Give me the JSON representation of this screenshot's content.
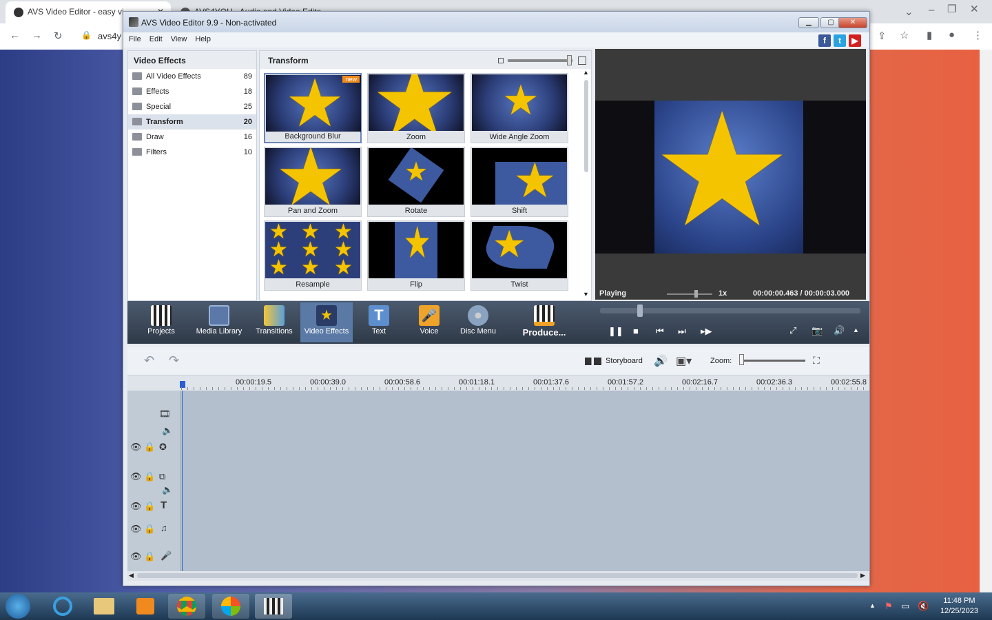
{
  "browser": {
    "tabs": [
      "AVS Video Editor - easy vi...",
      "AVS4YOU - Audio and Video Edito..."
    ],
    "address": "avs4y"
  },
  "app": {
    "title": "AVS Video Editor 9.9 - Non-activated",
    "menu": [
      "File",
      "Edit",
      "View",
      "Help"
    ]
  },
  "categories": {
    "header": "Video Effects",
    "items": [
      {
        "label": "All Video Effects",
        "count": "89"
      },
      {
        "label": "Effects",
        "count": "18"
      },
      {
        "label": "Special",
        "count": "25"
      },
      {
        "label": "Transform",
        "count": "20"
      },
      {
        "label": "Draw",
        "count": "16"
      },
      {
        "label": "Filters",
        "count": "10"
      }
    ]
  },
  "effects": {
    "header": "Transform",
    "new_badge": "new",
    "items": [
      "Background Blur",
      "Zoom",
      "Wide Angle Zoom",
      "Pan and Zoom",
      "Rotate",
      "Shift",
      "Resample",
      "Flip",
      "Twist"
    ]
  },
  "preview": {
    "status": "Playing",
    "speed": "1x",
    "time": "00:00:00.463 / 00:00:03.000"
  },
  "toolbar": {
    "items": [
      "Projects",
      "Media Library",
      "Transitions",
      "Video Effects",
      "Text",
      "Voice",
      "Disc Menu",
      "Produce..."
    ]
  },
  "timeline": {
    "storyboard": "Storyboard",
    "zoom_label": "Zoom:",
    "ticks": [
      "00:00:19.5",
      "00:00:39.0",
      "00:00:58.6",
      "00:01:18.1",
      "00:01:37.6",
      "00:01:57.2",
      "00:02:16.7",
      "00:02:36.3",
      "00:02:55.8"
    ]
  },
  "taskbar": {
    "time": "11:48 PM",
    "date": "12/25/2023"
  },
  "colors": {
    "accent": "#5a7aa5",
    "toolbar_bg": "#3a4656",
    "star": "#f5c400"
  }
}
